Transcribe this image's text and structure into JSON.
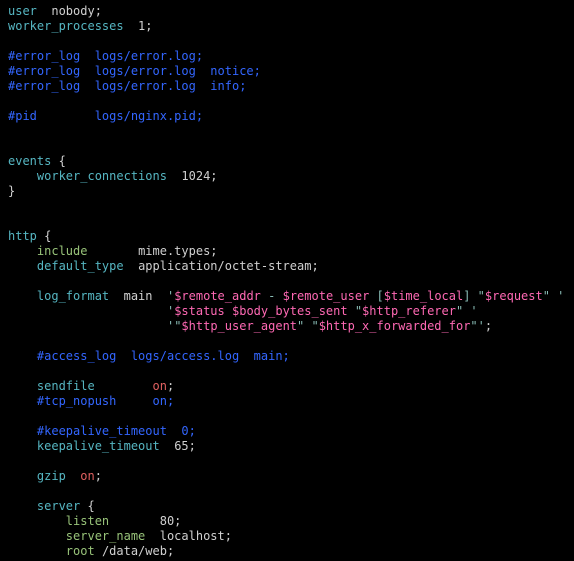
{
  "lines": {
    "l1_kw1": "user",
    "l1_v": "nobody;",
    "l2_kw1": "worker_processes",
    "l2_v": "1;",
    "l4": "#error_log  logs/error.log;",
    "l5": "#error_log  logs/error.log  notice;",
    "l6": "#error_log  logs/error.log  info;",
    "l8": "#pid        logs/nginx.pid;",
    "l11_kw": "events",
    "l11_b": "{",
    "l12_kw": "worker_connections",
    "l12_v": "1024;",
    "l13": "}",
    "l16_kw": "http",
    "l16_b": "{",
    "l17_kw": "include",
    "l17_v": "mime.types;",
    "l18_kw": "default_type",
    "l18_v": "application/octet-stream;",
    "l20_kw": "log_format",
    "l20_name": "main",
    "l20_q": "'",
    "l20_s1": "$remote_addr",
    "l20_m1": " - ",
    "l20_s2": "$remote_user",
    "l20_m2": " [",
    "l20_s3": "$time_local",
    "l20_m3": "] \"",
    "l20_s4": "$request",
    "l20_m4": "\" ",
    "l20_qe": "'",
    "l21_q": "'",
    "l21_s1": "$status",
    "l21_sp": " ",
    "l21_s2": "$body_bytes_sent",
    "l21_m1": " \"",
    "l21_s3": "$http_referer",
    "l21_m2": "\" ",
    "l21_qe": "'",
    "l22_q": "'",
    "l22_m0": "\"",
    "l22_s1": "$http_user_agent",
    "l22_m1": "\" \"",
    "l22_s2": "$http_x_forwarded_for",
    "l22_m2": "\"",
    "l22_qe": "'",
    "l22_semi": ";",
    "l24": "#access_log  logs/access.log  main;",
    "l26_kw": "sendfile",
    "l26_on": "on",
    "l26_semi": ";",
    "l27": "#tcp_nopush     on;",
    "l29": "#keepalive_timeout  0;",
    "l30_kw": "keepalive_timeout",
    "l30_v": "65;",
    "l32_kw": "gzip",
    "l32_on": "on",
    "l32_semi": ";",
    "l34_kw": "server",
    "l34_b": "{",
    "l35_kw": "listen",
    "l35_v": "80;",
    "l36_kw": "server_name",
    "l36_v": "localhost;",
    "l37_kw": "root",
    "l37_v": "/data/web;"
  }
}
